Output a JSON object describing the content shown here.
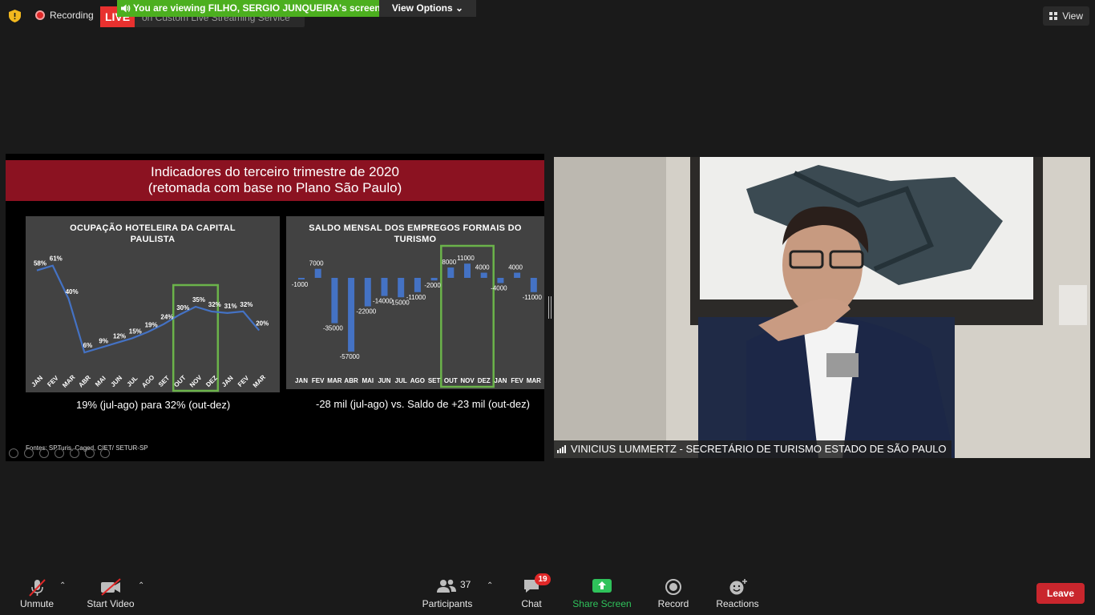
{
  "topbar": {
    "recording_label": "Recording",
    "live_label": "LIVE",
    "stream_label": "on Custom Live Streaming Service",
    "viewing_banner": "You are viewing FILHO, SERGIO JUNQUEIRA's screen",
    "view_options_label": "View Options",
    "view_label": "View"
  },
  "slide": {
    "title_line1": "Indicadores do terceiro trimestre de 2020",
    "title_line2": "(retomada com base no Plano São Paulo)",
    "left_caption": "19% (jul-ago) para 32% (out-dez)",
    "right_caption": "-28 mil (jul-ago) vs. Saldo de +23 mil (out-dez)",
    "sources": "Fontes: SPTuris, Caged, CIET/ SETUR-SP"
  },
  "chart_data": [
    {
      "type": "line",
      "title": "OCUPAÇÃO HOTELEIRA DA CAPITAL PAULISTA",
      "categories": [
        "JAN",
        "FEV",
        "MAR",
        "ABR",
        "MAI",
        "JUN",
        "JUL",
        "AGO",
        "SET",
        "OUT",
        "NOV",
        "DEZ",
        "JAN",
        "FEV",
        "MAR"
      ],
      "values": [
        58,
        61,
        40,
        6,
        9,
        12,
        15,
        19,
        24,
        30,
        35,
        32,
        31,
        32,
        20
      ],
      "data_labels": [
        "58%",
        "61%",
        "40%",
        "6%",
        "9%",
        "12%",
        "15%",
        "19%",
        "24%",
        "30%",
        "35%",
        "32%",
        "31%",
        "32%",
        "20%"
      ],
      "highlight": [
        "OUT",
        "NOV",
        "DEZ"
      ],
      "ylim": [
        0,
        70
      ],
      "line_color": "#4472c4",
      "highlight_color": "#6bb34a"
    },
    {
      "type": "bar",
      "title": "SALDO MENSAL DOS EMPREGOS FORMAIS DO TURISMO",
      "categories": [
        "JAN",
        "FEV",
        "MAR",
        "ABR",
        "MAI",
        "JUN",
        "JUL",
        "AGO",
        "SET",
        "OUT",
        "NOV",
        "DEZ",
        "JAN",
        "FEV",
        "MAR"
      ],
      "values": [
        -1000,
        7000,
        -35000,
        -57000,
        -22000,
        -14000,
        -15000,
        -11000,
        -2000,
        8000,
        11000,
        4000,
        -4000,
        4000,
        -11000
      ],
      "data_labels": [
        "-1000",
        "7000",
        "-35000",
        "-57000",
        "-22000",
        "-14000",
        "-15000",
        "-11000",
        "-2000",
        "8000",
        "11000",
        "4000",
        "-4000",
        "4000",
        "-11000"
      ],
      "highlight": [
        "OUT",
        "NOV",
        "DEZ"
      ],
      "ylim": [
        -60000,
        15000
      ],
      "bar_color": "#4472c4",
      "highlight_color": "#6bb34a"
    }
  ],
  "video": {
    "participant_name": "VINICIUS LUMMERTZ - SECRETÁRIO DE TURISMO ESTADO DE SÃO PAULO"
  },
  "toolbar": {
    "unmute_label": "Unmute",
    "start_video_label": "Start Video",
    "participants_label": "Participants",
    "participants_count": "37",
    "chat_label": "Chat",
    "chat_badge": "19",
    "share_screen_label": "Share Screen",
    "record_label": "Record",
    "reactions_label": "Reactions",
    "leave_label": "Leave"
  },
  "colors": {
    "live_red": "#e8312f",
    "banner_green": "#4caf1f",
    "share_green": "#2fc25b",
    "leave_red": "#c9262d",
    "slide_header": "#8b1221"
  }
}
